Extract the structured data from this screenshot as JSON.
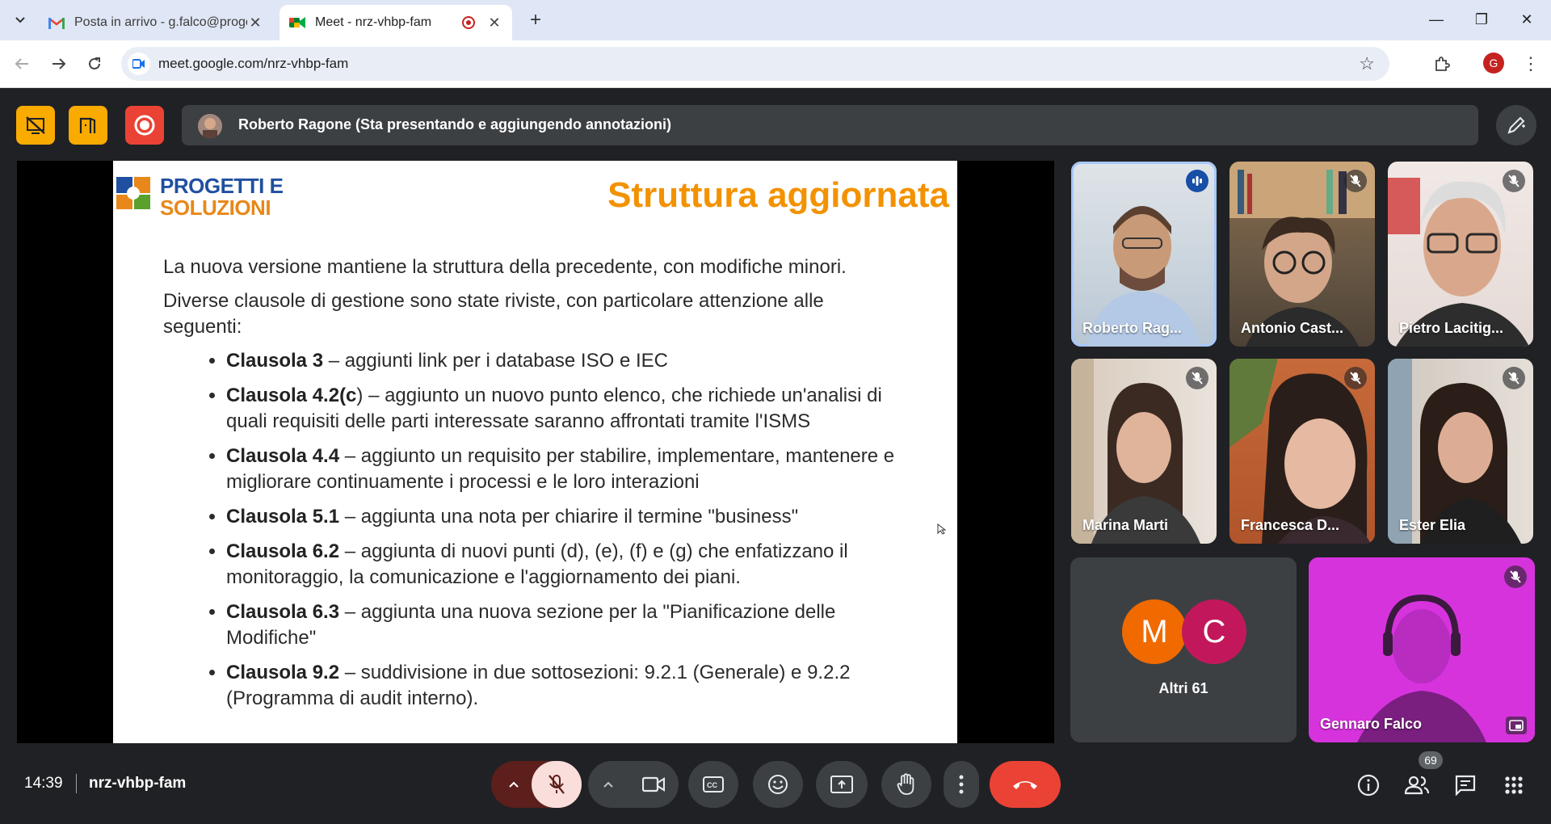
{
  "browser": {
    "tabs": [
      {
        "title": "Posta in arrivo - g.falco@progetti",
        "icon": "gmail-icon"
      },
      {
        "title": "Meet - nrz-vhbp-fam",
        "icon": "meet-icon",
        "recording": true
      }
    ],
    "url": "meet.google.com/nrz-vhbp-fam",
    "profile_initial": "G"
  },
  "meet": {
    "presenter_banner": "Roberto Ragone (Sta presentando e aggiungendo annotazioni)",
    "slide": {
      "logo_line1": "PROGETTI E",
      "logo_line2": "SOLUZIONI",
      "title": "Struttura aggiornata",
      "intro1": "La nuova versione mantiene la struttura della precedente, con modifiche minori.",
      "intro2": "Diverse clausole di gestione sono state riviste, con particolare attenzione alle seguenti:",
      "bullets": [
        {
          "bold": "Clausola 3",
          "text": " – aggiunti link per i database ISO e IEC"
        },
        {
          "bold": "Clausola 4.2(c",
          "text": ") – aggiunto un nuovo punto elenco, che richiede un'analisi di quali requisiti delle parti interessate saranno affrontati tramite l'ISMS"
        },
        {
          "bold": "Clausola 4.4",
          "text": " – aggiunto un requisito per stabilire, implementare, mantenere e migliorare continuamente i processi e le loro interazioni"
        },
        {
          "bold": "Clausola 5.1",
          "text": " – aggiunta una nota per chiarire il termine \"business\""
        },
        {
          "bold": "Clausola 6.2",
          "text": " – aggiunta di nuovi punti (d), (e), (f) e (g) che enfatizzano il monitoraggio, la comunicazione e l'aggiornamento dei piani."
        },
        {
          "bold": "Clausola 6.3",
          "text": " – aggiunta una nuova sezione per la \"Pianificazione delle Modifiche\""
        },
        {
          "bold": "Clausola 9.2",
          "text": " – suddivisione in due sottosezioni: 9.2.1 (Generale) e 9.2.2 (Programma di audit interno)."
        }
      ]
    },
    "participants": [
      {
        "name": "Roberto Rag...",
        "speaking": true
      },
      {
        "name": "Antonio Cast...",
        "muted": true
      },
      {
        "name": "Pietro Lacitig...",
        "muted": true
      },
      {
        "name": "Marina Marti",
        "muted": true
      },
      {
        "name": "Francesca D...",
        "muted": true
      },
      {
        "name": "Ester Elia",
        "muted": true
      }
    ],
    "others": {
      "avatar1": "M",
      "avatar2": "C",
      "label": "Altri 61"
    },
    "self": {
      "name": "Gennaro Falco",
      "muted": true
    },
    "time": "14:39",
    "meeting_code": "nrz-vhbp-fam",
    "people_count": "69"
  },
  "colors": {
    "accent_yellow": "#f9ab00",
    "record_red": "#ea4335",
    "end_call": "#ea4335",
    "slide_title": "#f39200"
  }
}
